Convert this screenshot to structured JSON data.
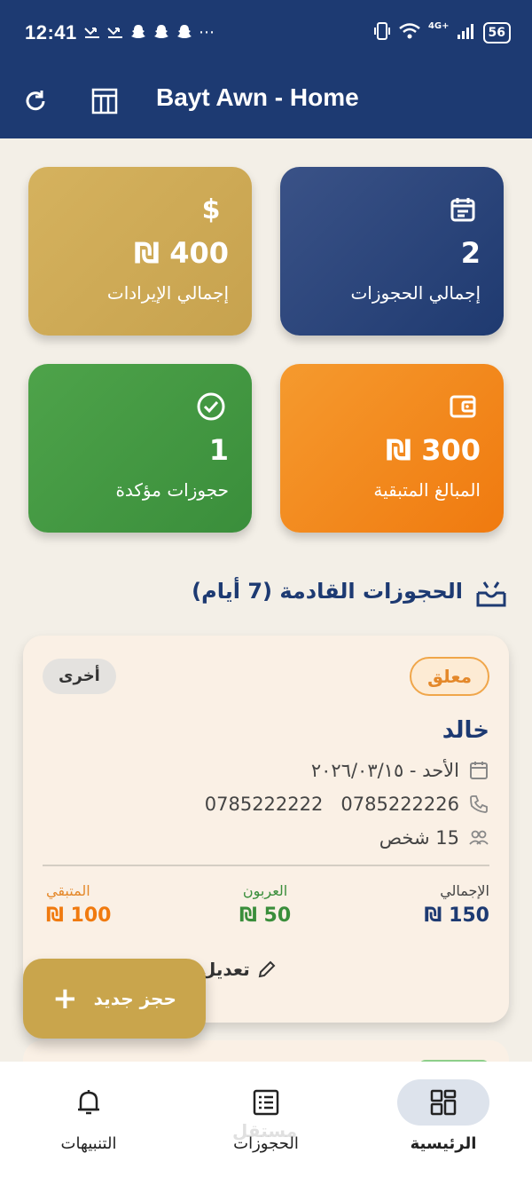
{
  "status_bar": {
    "time": "12:41",
    "notifications": [
      "missed-call-icon",
      "missed-call-icon",
      "snapchat-icon",
      "snapchat-icon",
      "snapchat-icon"
    ],
    "more": "⋯",
    "network": "4G+",
    "battery": "56"
  },
  "app_bar": {
    "title": "Bayt Awn - Home"
  },
  "stats": {
    "total_bookings": {
      "value": "2",
      "label": "إجمالي الحجوزات",
      "icon": "calendar-icon"
    },
    "total_revenue": {
      "value": "₪ 400",
      "label": "إجمالي الإيرادات",
      "icon": "dollar-icon",
      "symbol": "$"
    },
    "remaining_amounts": {
      "value": "₪ 300",
      "label": "المبالغ المتبقية",
      "icon": "wallet-icon"
    },
    "confirmed_bookings": {
      "value": "1",
      "label": "حجوزات مؤكدة",
      "icon": "check-circle-icon"
    }
  },
  "upcoming": {
    "title": "الحجوزات القادمة (7 أيام)"
  },
  "booking": {
    "status": "معلق",
    "type": "أخرى",
    "name": "خالد",
    "date": "الأحد - ٢٠٢٦/٠٣/١٥",
    "phones": "0785222222   0785222226",
    "guests": "15 شخص",
    "amounts": {
      "total_label": "الإجمالي",
      "total_value": "₪ 150",
      "deposit_label": "العربون",
      "deposit_value": "₪ 50",
      "remaining_label": "المتبقي",
      "remaining_value": "₪ 100"
    },
    "edit_label": "تعديل"
  },
  "fab": {
    "label": "حجز جديد",
    "plus": "+"
  },
  "bottom_nav": {
    "items": [
      {
        "label": "الرئيسية",
        "icon": "grid-icon",
        "active": true
      },
      {
        "label": "الحجوزات",
        "icon": "list-icon",
        "active": false
      },
      {
        "label": "التنبيهات",
        "icon": "bell-icon",
        "active": false
      }
    ]
  },
  "watermark": "مستقل",
  "colors": {
    "primary": "#1d3a72",
    "gold": "#c9a54c",
    "orange": "#f07a0f",
    "green": "#3a8e3b",
    "background": "#f3efe7"
  }
}
